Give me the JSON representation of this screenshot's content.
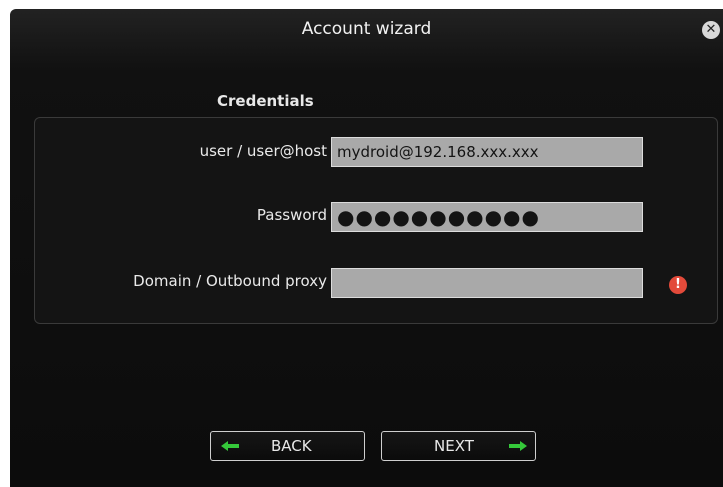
{
  "window": {
    "title": "Account wizard",
    "close_icon": "close-icon"
  },
  "credentials": {
    "section_title": "Credentials",
    "user_label": "user / user@host",
    "user_value": "mydroid@192.168.xxx.xxx",
    "password_label": "Password",
    "password_value": "●●●●●●●●●●●",
    "domain_label": "Domain / Outbound proxy",
    "domain_value": "",
    "warning_icon": "warning-icon"
  },
  "buttons": {
    "back_label": "BACK",
    "next_label": "NEXT",
    "back_icon": "arrow-left-icon",
    "next_icon": "arrow-right-icon",
    "arrow_color": "#35c83a"
  }
}
